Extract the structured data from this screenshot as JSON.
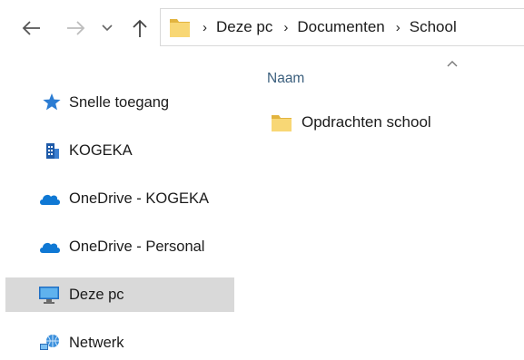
{
  "nav": {
    "back_icon": "arrow-left-icon",
    "forward_icon": "arrow-right-icon",
    "recent_icon": "chevron-down-icon",
    "up_icon": "arrow-up-icon"
  },
  "address": {
    "folder_icon": "folder-icon",
    "crumbs": [
      "Deze pc",
      "Documenten",
      "School"
    ],
    "separator": "›"
  },
  "navpane": {
    "items": [
      {
        "label": "Snelle toegang",
        "icon": "star-pin-icon",
        "selected": false
      },
      {
        "label": "KOGEKA",
        "icon": "building-icon",
        "selected": false
      },
      {
        "label": "OneDrive - KOGEKA",
        "icon": "cloud-icon",
        "selected": false
      },
      {
        "label": "OneDrive - Personal",
        "icon": "cloud-icon",
        "selected": false
      },
      {
        "label": "Deze pc",
        "icon": "monitor-icon",
        "selected": true
      },
      {
        "label": "Netwerk",
        "icon": "network-icon",
        "selected": false
      }
    ]
  },
  "content": {
    "column_header": "Naam",
    "sort_icon": "caret-up-icon",
    "files": [
      {
        "label": "Opdrachten school",
        "icon": "folder-icon"
      }
    ]
  },
  "colors": {
    "folder": "#f8d775",
    "folder_dark": "#e2b43f",
    "cloud": "#0f78d4",
    "selection": "#d9d9d9",
    "header_text": "#3b5f7d"
  }
}
